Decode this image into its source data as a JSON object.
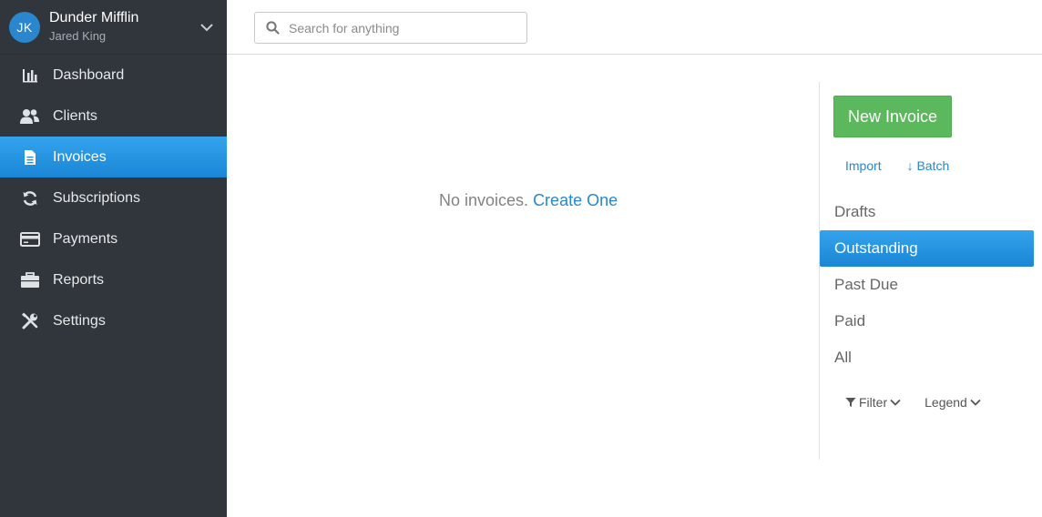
{
  "account": {
    "initials": "JK",
    "company": "Dunder Mifflin",
    "user": "Jared King"
  },
  "nav": [
    {
      "label": "Dashboard",
      "icon": "bar-chart-icon"
    },
    {
      "label": "Clients",
      "icon": "users-icon"
    },
    {
      "label": "Invoices",
      "icon": "document-icon",
      "active": true
    },
    {
      "label": "Subscriptions",
      "icon": "refresh-icon"
    },
    {
      "label": "Payments",
      "icon": "credit-card-icon"
    },
    {
      "label": "Reports",
      "icon": "briefcase-icon"
    },
    {
      "label": "Settings",
      "icon": "tools-icon"
    }
  ],
  "search": {
    "placeholder": "Search for anything",
    "value": ""
  },
  "main": {
    "empty_text": "No invoices.",
    "create_link": "Create One"
  },
  "panel": {
    "new_invoice": "New Invoice",
    "import": "Import",
    "batch": "↓ Batch",
    "statuses": [
      "Drafts",
      "Outstanding",
      "Past Due",
      "Paid",
      "All"
    ],
    "active_status": "Outstanding",
    "filter": "Filter",
    "legend": "Legend"
  },
  "colors": {
    "sidebar_bg": "#31363d",
    "accent": "#2a86cd",
    "new_button": "#5cb85c"
  }
}
